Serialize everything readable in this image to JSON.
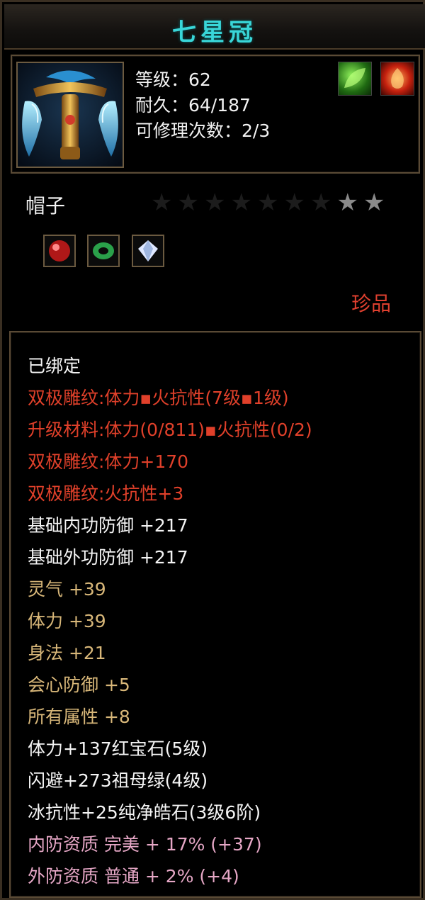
{
  "item": {
    "name": "七星冠",
    "level": "等级：62",
    "durability": "耐久：64/187",
    "repair": "可修理次数：2/3",
    "type": "帽子",
    "rarity": "珍品",
    "stars_total": 9,
    "stars_lit": 2
  },
  "lines": [
    {
      "text": "已绑定",
      "color": "white"
    },
    {
      "text": "双极雕纹:体力▪火抗性(7级▪1级)",
      "color": "red"
    },
    {
      "text": "升级材料:体力(0/811)▪火抗性(0/2)",
      "color": "red"
    },
    {
      "text": "双极雕纹:体力+170",
      "color": "red"
    },
    {
      "text": "双极雕纹:火抗性+3",
      "color": "red"
    },
    {
      "text": "基础内功防御 +217",
      "color": "white"
    },
    {
      "text": "基础外功防御 +217",
      "color": "white"
    },
    {
      "text": "灵气 +39",
      "color": "gold"
    },
    {
      "text": "体力 +39",
      "color": "gold"
    },
    {
      "text": "身法 +21",
      "color": "gold"
    },
    {
      "text": "会心防御 +5",
      "color": "gold"
    },
    {
      "text": "所有属性 +8",
      "color": "gold"
    },
    {
      "text": "体力+137红宝石(5级)",
      "color": "white"
    },
    {
      "text": "闪避+273祖母绿(4级)",
      "color": "white"
    },
    {
      "text": "冰抗性+25纯净皓石(3级6阶)",
      "color": "white"
    },
    {
      "text": "内防资质 完美 + 17% (+37)",
      "color": "pink"
    },
    {
      "text": "外防资质 普通 + 2% (+4)",
      "color": "pink"
    }
  ],
  "colors": {
    "title": "#39d6d8",
    "red": "#e0402a",
    "gold": "#d8b779",
    "pink": "#e6a7c6",
    "white": "#f4f4f4"
  },
  "icons": {
    "item_icon": "crown-icon",
    "top_gems": [
      "green-leaf-gem-icon",
      "red-fire-gem-icon"
    ],
    "sockets": [
      "ruby-socket-icon",
      "emerald-socket-icon",
      "diamond-socket-icon"
    ]
  }
}
